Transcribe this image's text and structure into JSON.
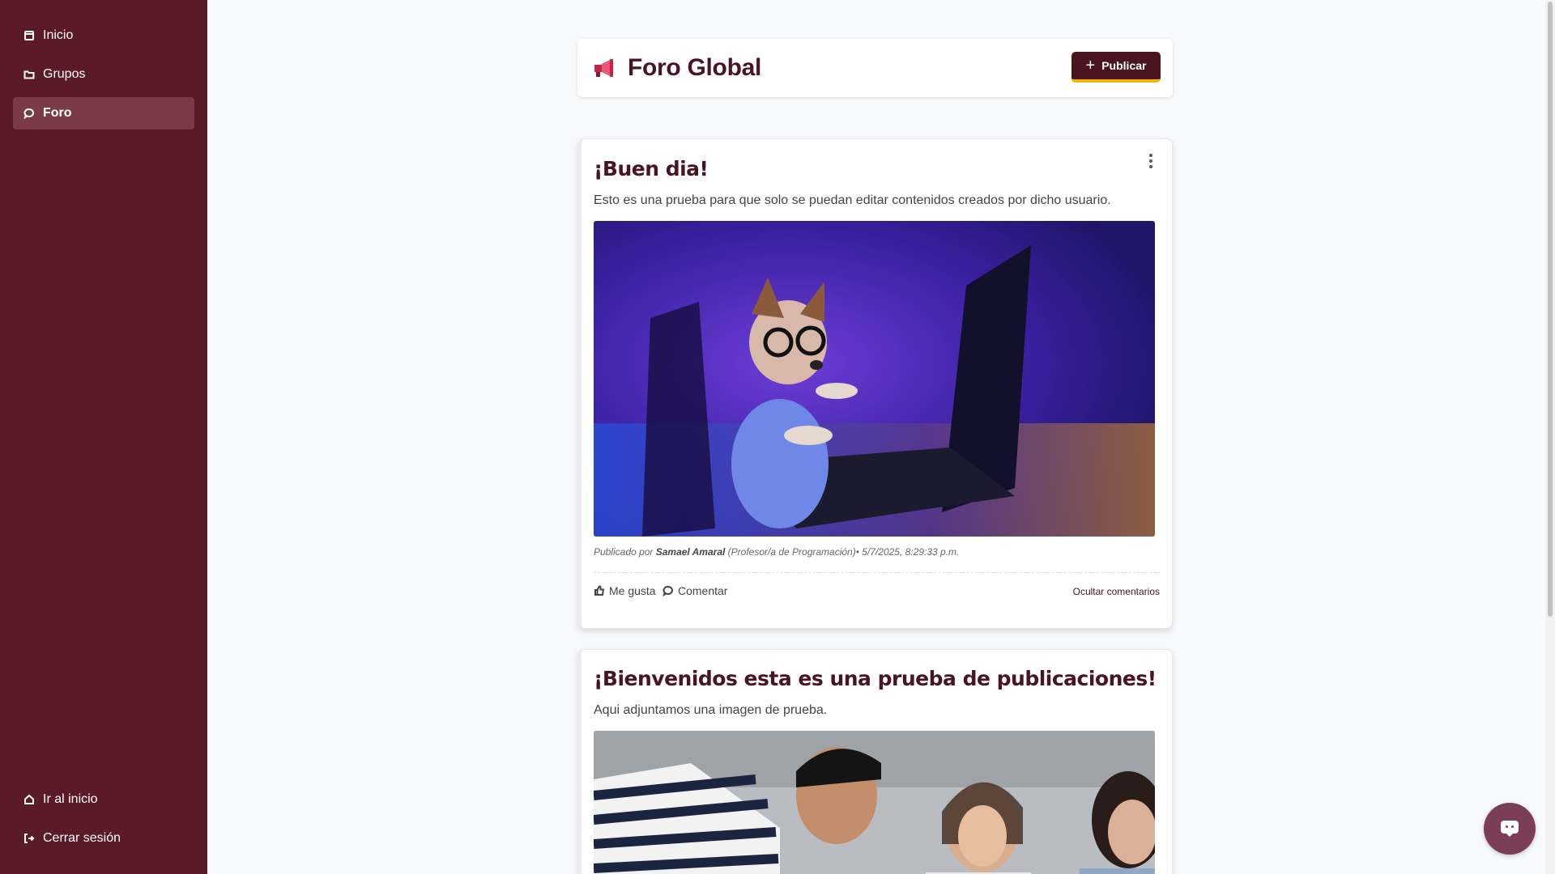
{
  "sidebar": {
    "items": [
      {
        "label": "Inicio",
        "icon": "calendar-icon",
        "active": false
      },
      {
        "label": "Grupos",
        "icon": "folder-icon",
        "active": false
      },
      {
        "label": "Foro",
        "icon": "chat-bubble-icon",
        "active": true
      }
    ],
    "bottom": [
      {
        "label": "Ir al inicio",
        "icon": "home-icon"
      },
      {
        "label": "Cerrar sesión",
        "icon": "logout-icon"
      }
    ]
  },
  "header": {
    "title": "Foro Global",
    "icon": "megaphone-icon",
    "publish_label": "Publicar"
  },
  "posts": [
    {
      "title": "¡Buen dia!",
      "body": "Esto es una prueba para que solo se puedan editar contenidos creados por dicho usuario.",
      "image": "dog-with-glasses-laptop",
      "meta_prefix": "Publicado por ",
      "author": "Samael Amaral",
      "role": " (Profesor/a de Programación)",
      "timestamp": "• 5/7/2025, 8:29:33 p.m.",
      "like_label": "Me gusta",
      "comment_label": "Comentar",
      "hide_comments_label": "Ocultar comentarios"
    },
    {
      "title": "¡Bienvenidos esta es una prueba de publicaciones!",
      "body": "Aqui adjuntamos una imagen de prueba.",
      "image": "students-studying"
    }
  ],
  "colors": {
    "sidebar_bg": "#5a1b27",
    "accent": "#4a1520",
    "button_underline": "#f2b705",
    "chat_fab": "#7b3d58"
  }
}
